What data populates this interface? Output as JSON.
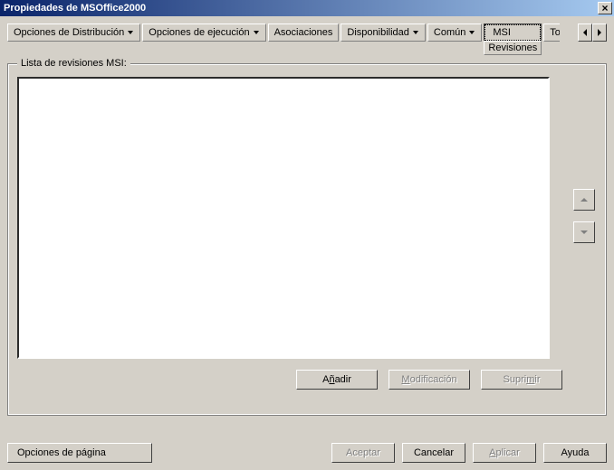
{
  "title": "Propiedades de MSOffice2000",
  "tabs": {
    "distribucion": "Opciones de Distribución",
    "ejecucion": "Opciones de ejecución",
    "asociaciones": "Asociaciones",
    "disponibilidad": "Disponibilidad",
    "comun": "Común",
    "msi": "MSI",
    "msi_sub": "Revisiones",
    "to_partial": "To"
  },
  "group": {
    "legend": "Lista de revisiones MSI:"
  },
  "buttons": {
    "add": "Añadir",
    "modify": "Modificación",
    "delete": "Suprimir",
    "page_options": "Opciones de página",
    "accept": "Aceptar",
    "cancel": "Cancelar",
    "apply": "Aplicar",
    "help": "Ayuda"
  }
}
